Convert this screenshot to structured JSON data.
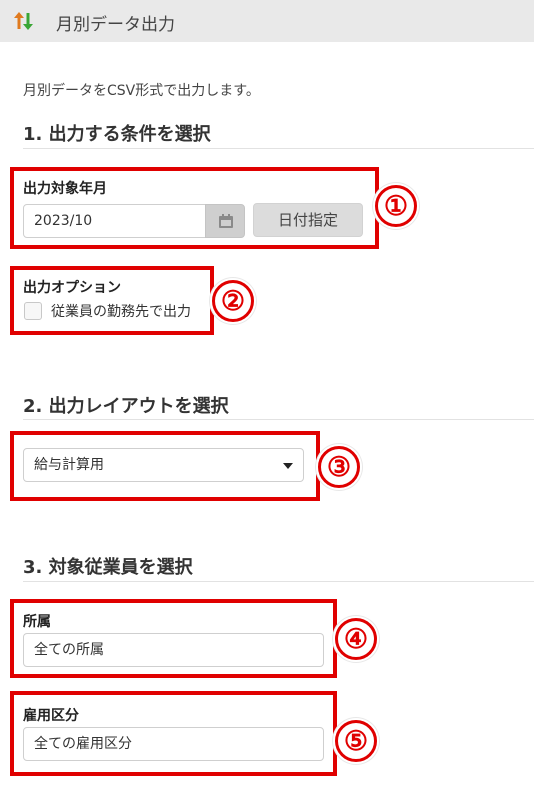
{
  "header": {
    "title": "月別データ出力",
    "icon": "sort-arrows-icon"
  },
  "description": "月別データをCSV形式で出力します。",
  "section1": {
    "heading": "1. 出力する条件を選択",
    "target_month": {
      "label": "出力対象年月",
      "value": "2023/10",
      "date_button_label": "日付指定"
    },
    "options": {
      "label": "出力オプション",
      "checkbox_label": "従業員の勤務先で出力",
      "checked": false
    }
  },
  "section2": {
    "heading": "2. 出力レイアウトを選択",
    "layout_selected": "給与計算用"
  },
  "section3": {
    "heading": "3. 対象従業員を選択",
    "affiliation": {
      "label": "所属",
      "value": "全ての所属"
    },
    "employment": {
      "label": "雇用区分",
      "value": "全ての雇用区分"
    }
  },
  "annotations": {
    "colors": {
      "highlight": "#e00000"
    },
    "badges": [
      "①",
      "②",
      "③",
      "④",
      "⑤"
    ]
  }
}
